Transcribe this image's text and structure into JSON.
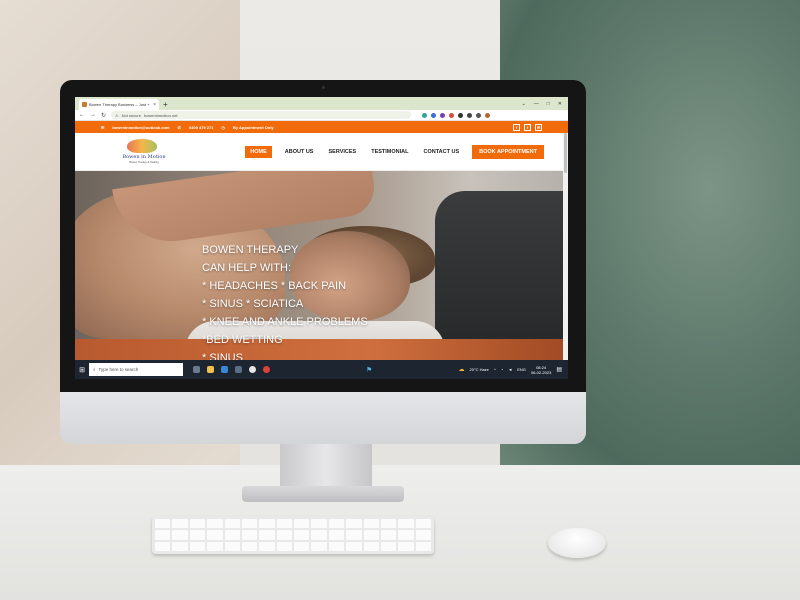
{
  "browser": {
    "tab_title": "Bowen Therapy Business – Just +",
    "tab_close": "×",
    "new_tab": "+",
    "window_controls": [
      "⌄",
      "—",
      "□",
      "✕"
    ],
    "security_label": "Not secure",
    "url": "boweninmotion.net"
  },
  "topbar": {
    "email": "boweninmotion@outlook.com",
    "phone": "0409 479 271",
    "appointment": "By Appointment Only",
    "social": [
      "f",
      "f",
      "✉"
    ]
  },
  "site": {
    "logo_text": "Bowen in Motion",
    "logo_sub": "Bowen Therapy & Healing",
    "nav": [
      "HOME",
      "ABOUT US",
      "SERVICES",
      "TESTIMONIAL",
      "CONTACT US"
    ],
    "cta": "BOOK APPOINTMENT"
  },
  "hero": {
    "lines": [
      "BOWEN THERAPY",
      "CAN HELP WITH:",
      "* HEADACHES * BACK PAIN",
      "* SINUS * SCIATICA",
      "* KNEE AND ANKLE PROBLEMS",
      "*BED WETTING",
      "* SINUS"
    ]
  },
  "taskbar": {
    "search_placeholder": "Type here to search",
    "weather": "20°C  Haze",
    "language": "ENG",
    "time": "08:24",
    "date": "06-02-2023"
  }
}
